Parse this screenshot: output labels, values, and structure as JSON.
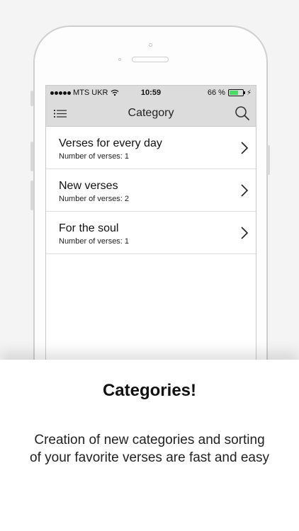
{
  "status_bar": {
    "carrier": "MTS UKR",
    "time": "10:59",
    "battery": "66 %",
    "battery_level": 0.66,
    "battery_color": "#4cd964"
  },
  "nav": {
    "title": "Category",
    "left_icon": "menu-list-icon",
    "right_icon": "search-icon"
  },
  "categories": [
    {
      "title": "Verses for every day",
      "count_text": "Number of verses: 1"
    },
    {
      "title": "New verses",
      "count_text": "Number of verses: 2"
    },
    {
      "title": "For the soul",
      "count_text": "Number of verses: 1"
    }
  ],
  "promo": {
    "headline": "Categories!",
    "description_line1": "Creation of new categories and sorting",
    "description_line2": "of your favorite verses are fast and easy"
  }
}
